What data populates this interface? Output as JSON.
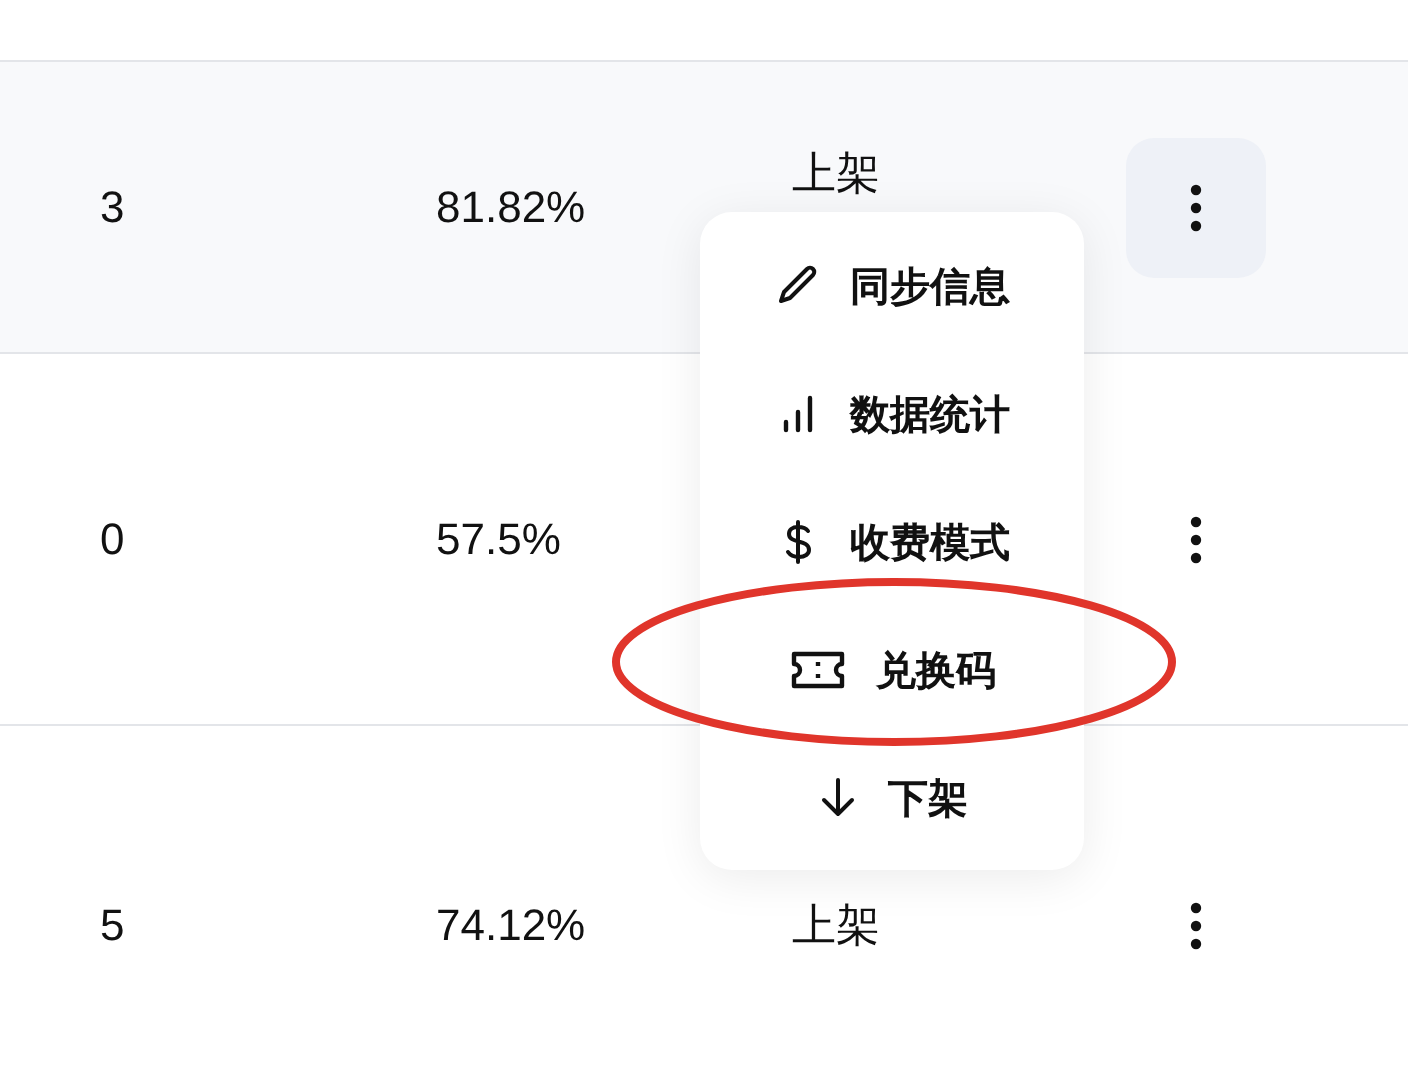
{
  "table": {
    "rows": [
      {
        "count": "3",
        "rate": "81.82%",
        "status": "上架",
        "active": true
      },
      {
        "count": "0",
        "rate": "57.5%",
        "active": false
      },
      {
        "count": "5",
        "rate": "74.12%",
        "status": "上架",
        "active": false
      }
    ]
  },
  "menu": {
    "items": [
      {
        "kind": "pencil",
        "label": "同步信息",
        "highlighted": false
      },
      {
        "kind": "chart",
        "label": "数据统计",
        "highlighted": false
      },
      {
        "kind": "dollar",
        "label": "收费模式",
        "highlighted": false
      },
      {
        "kind": "ticket",
        "label": "兑换码",
        "highlighted": true
      },
      {
        "kind": "down",
        "label": "下架",
        "highlighted": false
      }
    ]
  }
}
